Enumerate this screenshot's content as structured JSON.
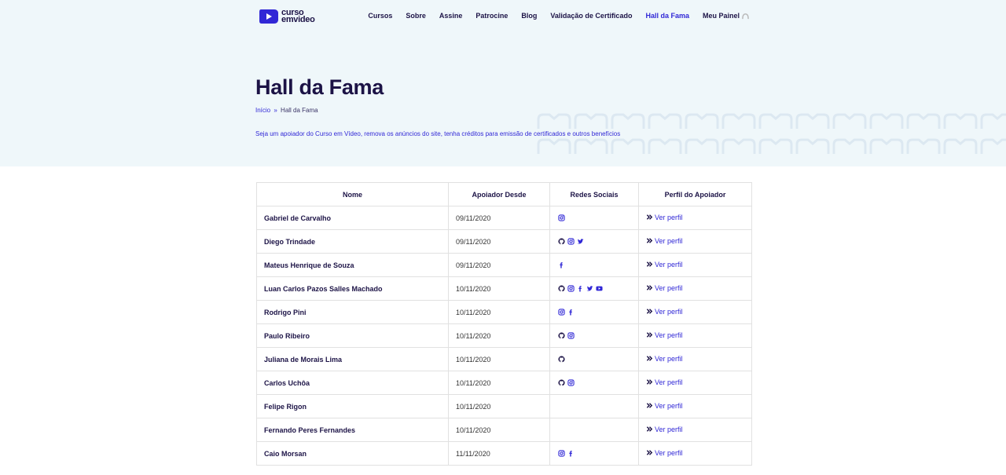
{
  "brand": {
    "line1": "curso",
    "line2": "emvideo",
    "color": "#3128d6"
  },
  "nav": {
    "items": [
      {
        "label": "Cursos"
      },
      {
        "label": "Sobre"
      },
      {
        "label": "Assine"
      },
      {
        "label": "Patrocine"
      },
      {
        "label": "Blog"
      },
      {
        "label": "Validação de Certificado"
      },
      {
        "label": "Hall da Fama",
        "active": true
      },
      {
        "label": "Meu Painel"
      }
    ]
  },
  "hero": {
    "title": "Hall da Fama",
    "breadcrumb": {
      "home": "Início",
      "separator": "»",
      "current": "Hall da Fama"
    },
    "tagline": "Seja um apoiador do Curso em Vídeo, remova os anúncios do site, tenha créditos para emissão de certificados e outros benefícios"
  },
  "table": {
    "headers": [
      "Nome",
      "Apoiador Desde",
      "Redes Sociais",
      "Perfil do Apoiador"
    ],
    "profile_link_label": "Ver perfil",
    "rows": [
      {
        "name": "Gabriel de Carvalho",
        "since": "09/11/2020",
        "social": [
          "instagram"
        ]
      },
      {
        "name": "Diego Trindade",
        "since": "09/11/2020",
        "social": [
          "github",
          "instagram",
          "twitter"
        ]
      },
      {
        "name": "Mateus Henrique de Souza",
        "since": "09/11/2020",
        "social": [
          "facebook"
        ]
      },
      {
        "name": "Luan Carlos Pazos Salles Machado",
        "since": "10/11/2020",
        "social": [
          "github",
          "instagram",
          "facebook",
          "twitter",
          "youtube"
        ]
      },
      {
        "name": "Rodrigo Pini",
        "since": "10/11/2020",
        "social": [
          "instagram",
          "facebook"
        ]
      },
      {
        "name": "Paulo Ribeiro",
        "since": "10/11/2020",
        "social": [
          "github",
          "instagram"
        ]
      },
      {
        "name": "Juliana de Morais Lima",
        "since": "10/11/2020",
        "social": [
          "github"
        ]
      },
      {
        "name": "Carlos Uchôa",
        "since": "10/11/2020",
        "social": [
          "github",
          "instagram"
        ]
      },
      {
        "name": "Felipe Rigon",
        "since": "10/11/2020",
        "social": []
      },
      {
        "name": "Fernando Peres Fernandes",
        "since": "10/11/2020",
        "social": []
      },
      {
        "name": "Caio Morsan",
        "since": "11/11/2020",
        "social": [
          "instagram",
          "facebook"
        ]
      }
    ]
  }
}
